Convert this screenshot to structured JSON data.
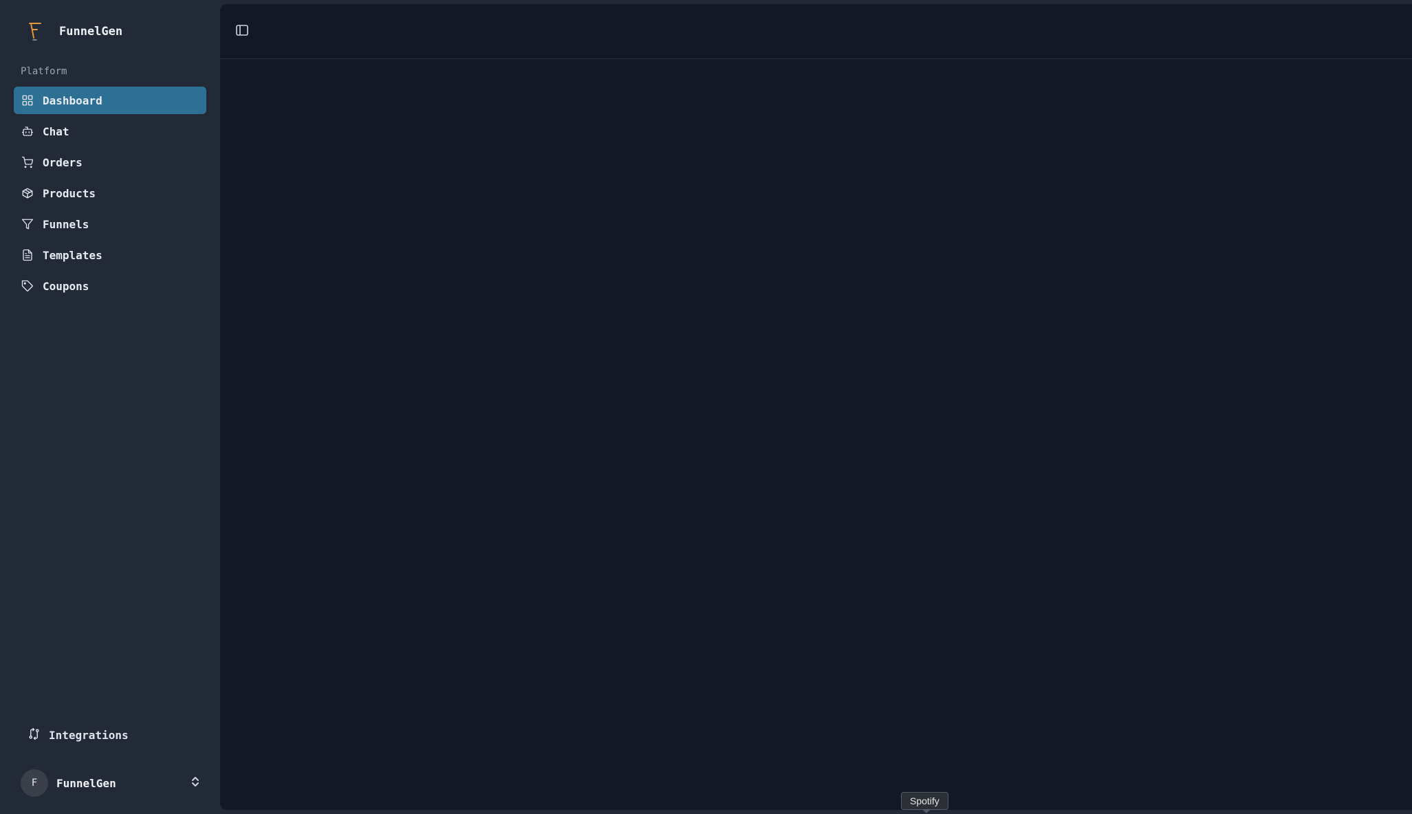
{
  "brand": {
    "name": "FunnelGen",
    "logo_icon": "funnelgen-logo-icon",
    "logo_color": "#e5953a"
  },
  "sidebar": {
    "section_label": "Platform",
    "items": [
      {
        "label": "Dashboard",
        "icon": "grid-icon",
        "active": true
      },
      {
        "label": "Chat",
        "icon": "bot-icon"
      },
      {
        "label": "Orders",
        "icon": "cart-icon"
      },
      {
        "label": "Products",
        "icon": "box-icon"
      },
      {
        "label": "Funnels",
        "icon": "filter-icon"
      },
      {
        "label": "Templates",
        "icon": "document-icon"
      },
      {
        "label": "Coupons",
        "icon": "tag-icon"
      }
    ],
    "integrations_label": "Integrations",
    "user": {
      "initial": "F",
      "name": "FunnelGen"
    }
  },
  "tooltip": {
    "text": "Spotify"
  },
  "colors": {
    "accent": "#2e7093",
    "sidebar_bg": "#222a38",
    "main_bg": "#131826"
  }
}
